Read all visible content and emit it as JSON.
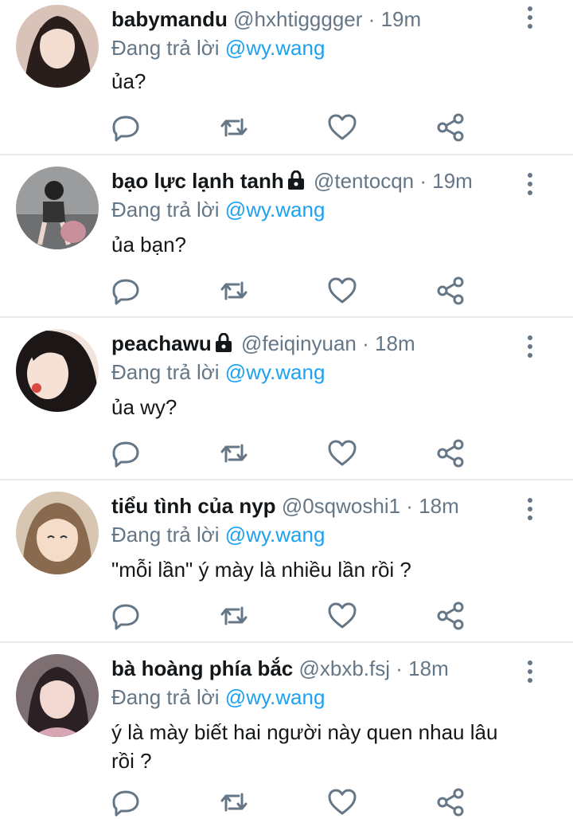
{
  "replying_label": "Đang trả lời",
  "replying_to": "@wy.wang",
  "tweets": [
    {
      "name": "babymandu",
      "handle": "@hxhtigggger",
      "separator": "·",
      "time": "19m",
      "text": "ủa?",
      "locked": false
    },
    {
      "name": "bạo lực lạnh tanh",
      "handle": "@tentocqn",
      "separator": "·",
      "time": "19m",
      "text": "ủa bạn?",
      "locked": true
    },
    {
      "name": "peachawu",
      "handle": "@feiqinyuan",
      "separator": "·",
      "time": "18m",
      "text": "ủa wy?",
      "locked": true
    },
    {
      "name": "tiểu tình của nyp",
      "handle": "@0sqwoshi1",
      "separator": "·",
      "time": "18m",
      "text": "\"mỗi lần\" ý mày là nhiều lần rồi ?",
      "locked": false
    },
    {
      "name": "bà hoàng phía bắc",
      "handle": "@xbxb.fsj",
      "separator": "·",
      "time": "18m",
      "text": "ý là mày biết hai người này quen nhau lâu rồi ?",
      "locked": false
    }
  ],
  "icons": {
    "reply": "reply-icon",
    "retweet": "retweet-icon",
    "like": "like-icon",
    "share": "share-icon",
    "more": "more-icon",
    "lock": "lock-icon"
  },
  "colors": {
    "accent": "#1da1f2",
    "secondary_text": "#657786",
    "divider": "#e6ecf0"
  }
}
